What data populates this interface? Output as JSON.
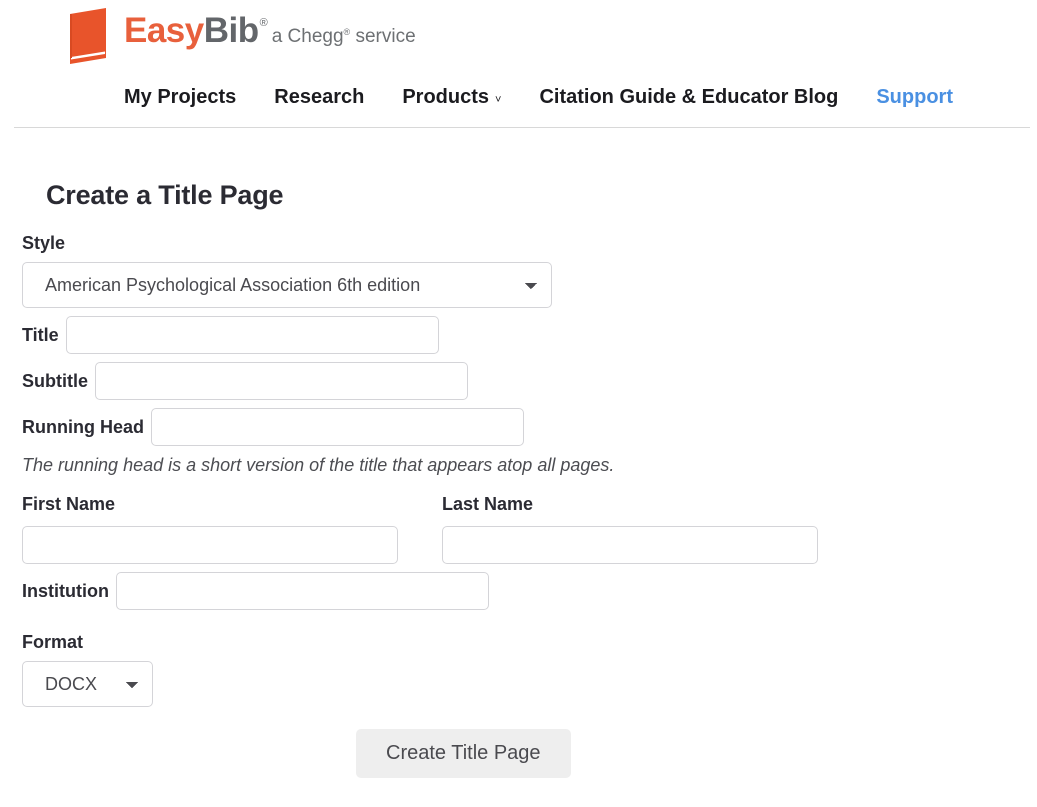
{
  "brand": {
    "name_part_1": "Easy",
    "name_part_2": "Bib",
    "registered_mark": "®",
    "tagline_before": "a Chegg",
    "tagline_mark": "®",
    "tagline_after": " service",
    "orange": "#e8603c",
    "gray": "#63666a"
  },
  "nav": {
    "items": [
      {
        "label": "My Projects",
        "has_caret": false,
        "highlight": false
      },
      {
        "label": "Research",
        "has_caret": false,
        "highlight": false
      },
      {
        "label": "Products",
        "has_caret": true,
        "caret": "˅",
        "highlight": false
      },
      {
        "label": "Citation Guide & Educator Blog",
        "has_caret": false,
        "highlight": false
      },
      {
        "label": "Support",
        "has_caret": false,
        "highlight": true
      }
    ],
    "support_color": "#4a90e2"
  },
  "page": {
    "title": "Create a Title Page"
  },
  "form": {
    "style": {
      "label": "Style",
      "selected": "American Psychological Association 6th edition",
      "options": [
        "American Psychological Association 6th edition"
      ]
    },
    "title": {
      "label": "Title",
      "value": "",
      "placeholder": ""
    },
    "subtitle": {
      "label": "Subtitle",
      "value": "",
      "placeholder": ""
    },
    "running_head": {
      "label": "Running Head",
      "value": "",
      "placeholder": "",
      "hint": "The running head is a short version of the title that appears atop all pages."
    },
    "first_name": {
      "label": "First Name",
      "value": "",
      "placeholder": ""
    },
    "last_name": {
      "label": "Last Name",
      "value": "",
      "placeholder": ""
    },
    "institution": {
      "label": "Institution",
      "value": "",
      "placeholder": ""
    },
    "format": {
      "label": "Format",
      "selected": "DOCX",
      "options": [
        "DOCX"
      ]
    },
    "submit_label": "Create Title Page"
  }
}
